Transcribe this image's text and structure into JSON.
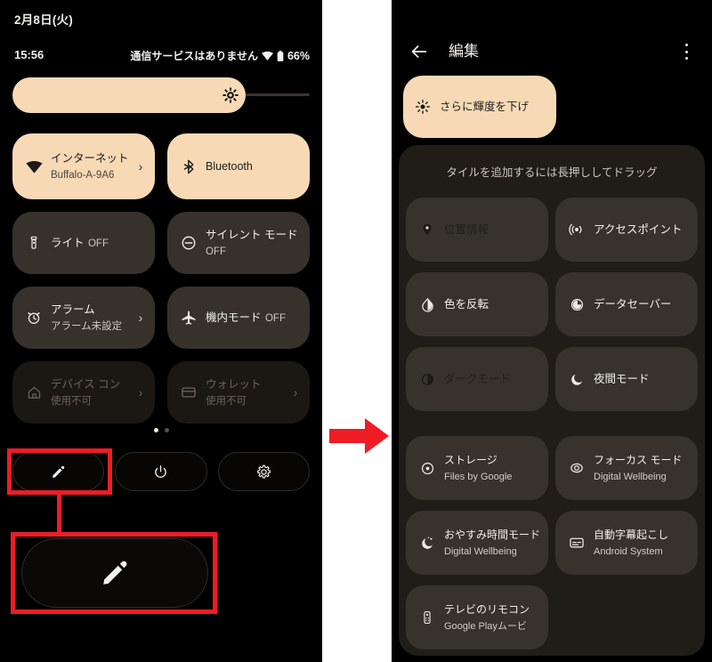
{
  "left_phone": {
    "status_bar": {
      "date": "2月8日(火)",
      "time": "15:56",
      "carrier": "通信サービスはありません",
      "wifi_icon": "wifi-icon",
      "battery_icon": "battery-icon",
      "battery": "66%"
    },
    "brightness": {
      "label": "brightness-slider",
      "icon": "brightness-icon",
      "level_percent": 78
    },
    "tiles": [
      {
        "title": "インターネット",
        "sub": "Buffalo-A-9A6",
        "icon": "wifi-icon",
        "state": "on",
        "chevron": "›"
      },
      {
        "title": "Bluetooth",
        "sub": "",
        "icon": "bluetooth-icon",
        "state": "on",
        "chevron": ""
      },
      {
        "title": "ライト",
        "sub": "OFF",
        "icon": "flashlight-icon",
        "state": "off",
        "chevron": ""
      },
      {
        "title": "サイレント モード",
        "sub": "OFF",
        "icon": "do-not-disturb-icon",
        "state": "off",
        "chevron": ""
      },
      {
        "title": "アラーム",
        "sub": "アラーム未設定",
        "icon": "alarm-icon",
        "state": "off",
        "chevron": "›"
      },
      {
        "title": "機内モード",
        "sub": "OFF",
        "icon": "airplane-icon",
        "state": "off",
        "chevron": ""
      },
      {
        "title": "デバイス コン",
        "sub": "使用不可",
        "icon": "home-icon",
        "state": "disabled",
        "chevron": "›"
      },
      {
        "title": "ウォレット",
        "sub": "使用不可",
        "icon": "wallet-icon",
        "state": "disabled",
        "chevron": "›"
      }
    ],
    "page_dots": {
      "count": 2,
      "active_index": 0
    },
    "actions": [
      {
        "name": "edit-button",
        "icon": "pencil-icon"
      },
      {
        "name": "power-button",
        "icon": "power-icon"
      },
      {
        "name": "settings-button",
        "icon": "gear-icon"
      }
    ],
    "callout": {
      "icon": "pencil-icon",
      "name": "edit-button-zoomed"
    }
  },
  "annotations": {
    "highlight_color": "#ee1c25",
    "arrow": "arrow-right",
    "boxes": [
      "edit-button-highlight",
      "edit-button-zoom-highlight"
    ]
  },
  "right_phone": {
    "header": {
      "back_icon": "back-arrow-icon",
      "title": "編集",
      "more_icon": "overflow-menu-icon"
    },
    "added_tile": {
      "title": "さらに輝度を下げ",
      "icon": "dim-brightness-icon",
      "state": "on"
    },
    "add_panel": {
      "hint": "タイルを追加するには長押ししてドラッグ",
      "tiles_group_1": [
        {
          "title": "位置情報",
          "sub": "",
          "icon": "location-pin-icon",
          "state": "on"
        },
        {
          "title": "アクセスポイント",
          "sub": "",
          "icon": "hotspot-icon",
          "state": "off"
        },
        {
          "title": "色を反転",
          "sub": "",
          "icon": "invert-colors-icon",
          "state": "off"
        },
        {
          "title": "データセーバー",
          "sub": "",
          "icon": "data-saver-icon",
          "state": "off"
        },
        {
          "title": "ダークモード",
          "sub": "",
          "icon": "dark-mode-icon",
          "state": "on"
        },
        {
          "title": "夜間モード",
          "sub": "",
          "icon": "night-light-icon",
          "state": "off"
        }
      ],
      "tiles_group_2": [
        {
          "title": "ストレージ",
          "sub": "Files by Google",
          "icon": "storage-icon",
          "state": "off"
        },
        {
          "title": "フォーカス モード",
          "sub": "Digital Wellbeing",
          "icon": "focus-mode-icon",
          "state": "off"
        },
        {
          "title": "おやすみ時間モード",
          "sub": "Digital Wellbeing",
          "icon": "bedtime-icon",
          "state": "off"
        },
        {
          "title": "自動字幕起こし",
          "sub": "Android System",
          "icon": "live-caption-icon",
          "state": "off"
        },
        {
          "title": "テレビのリモコン",
          "sub": "Google Playムービ",
          "icon": "tv-remote-icon",
          "state": "off"
        }
      ]
    }
  },
  "colors": {
    "accent_peach": "#f7d9b5",
    "tile_dark": "#36312b",
    "panel_dark": "#201c18",
    "phone_bg": "#000000",
    "annotation_red": "#ee1c25"
  }
}
